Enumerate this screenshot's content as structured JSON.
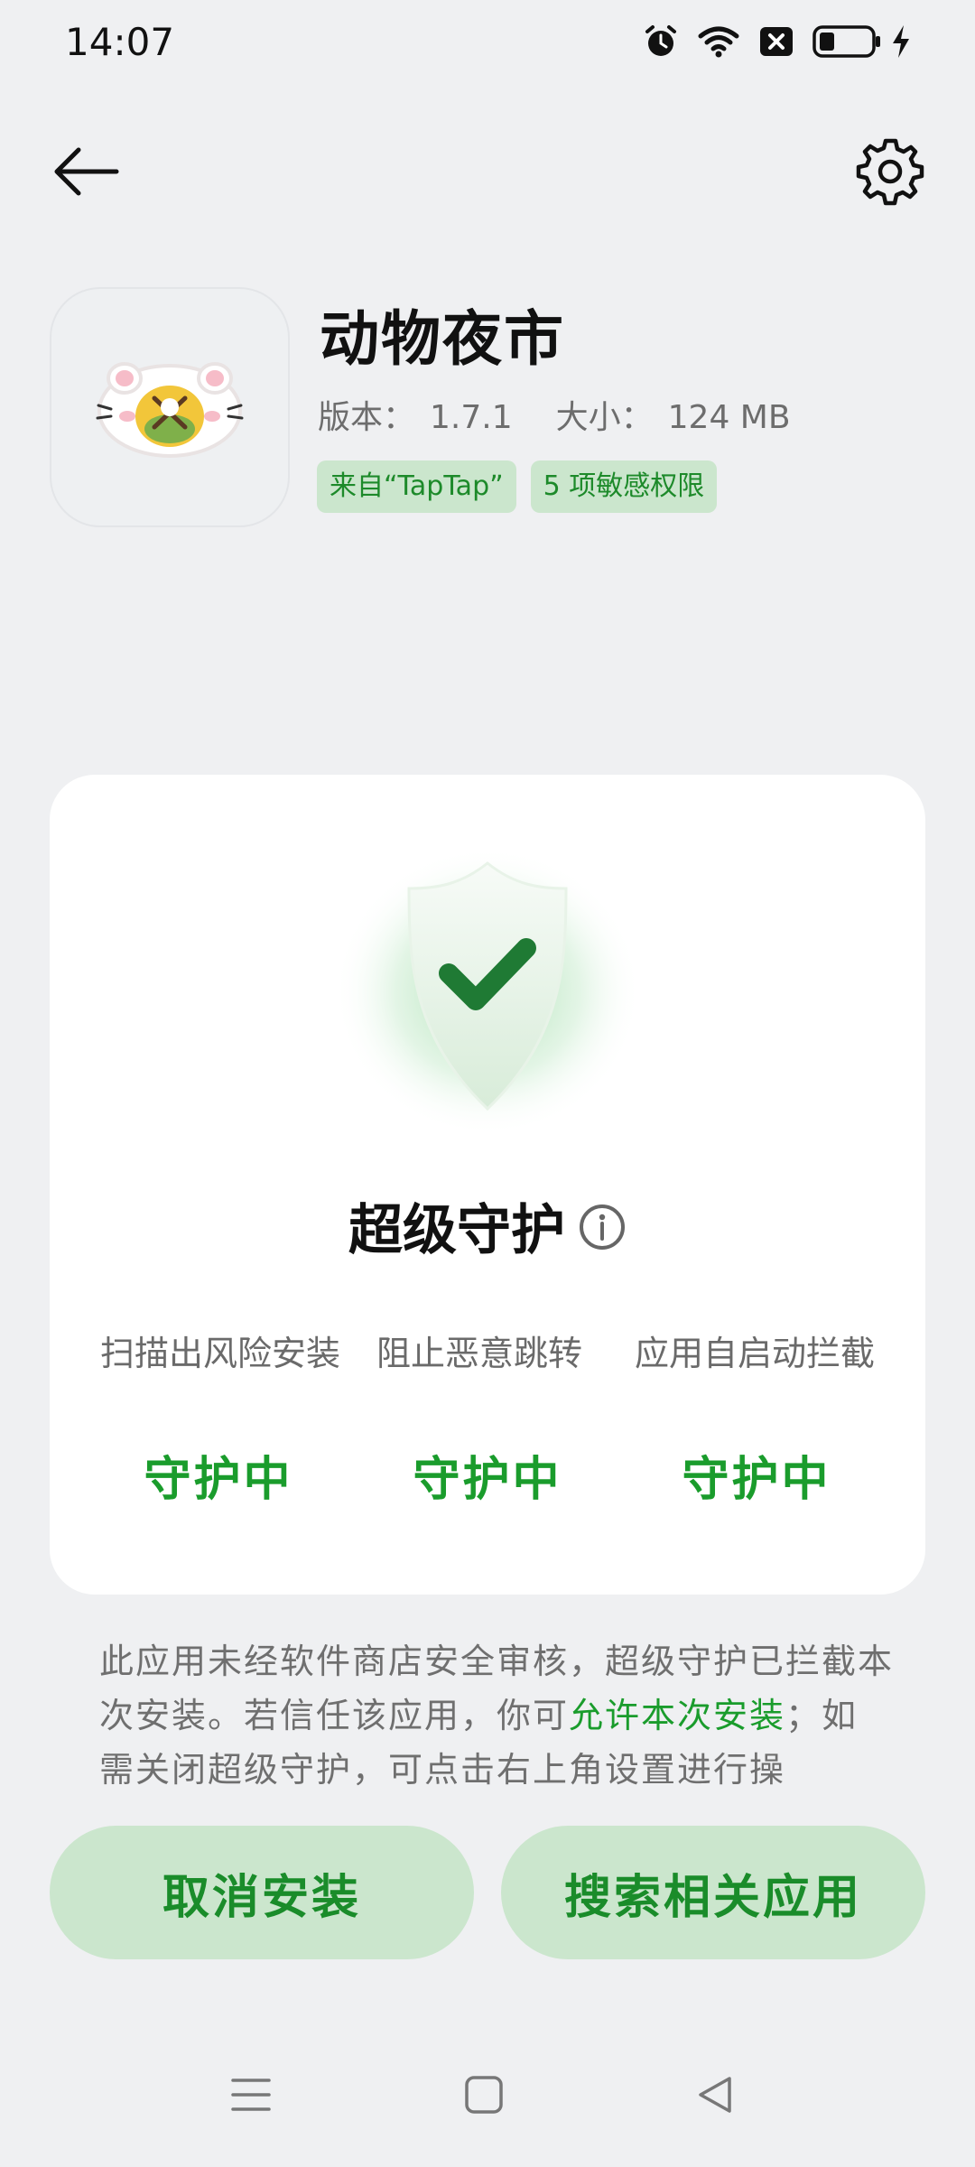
{
  "status_bar": {
    "time": "14:07",
    "icons": [
      "alarm-icon",
      "wifi-icon",
      "sim-off-icon",
      "battery-icon",
      "charging-icon"
    ]
  },
  "top_bar": {
    "back_icon": "back-arrow-icon",
    "settings_icon": "gear-icon"
  },
  "app": {
    "name": "动物夜市",
    "version_label": "版本：",
    "version": "1.7.1",
    "size_label": "大小：",
    "size": "124 MB",
    "source_chip": "来自“TapTap”",
    "permissions_chip": "5 项敏感权限"
  },
  "protection_card": {
    "title": "超级守护",
    "features": [
      {
        "label": "扫描出风险安装",
        "status": "守护中"
      },
      {
        "label": "阻止恶意跳转",
        "status": "守护中"
      },
      {
        "label": "应用自启动拦截",
        "status": "守护中"
      }
    ]
  },
  "notice": {
    "text_before": "此应用未经软件商店安全审核，超级守护已拦截本次安装。若信任该应用，你可",
    "link": "允许本次安装",
    "text_after": "；如需关闭超级守护，可点击右上角设置进行操"
  },
  "actions": {
    "cancel": "取消安装",
    "search": "搜索相关应用"
  },
  "colors": {
    "accent": "#1a9c2c",
    "chip_bg": "#cbe6cd",
    "background": "#eff0f2"
  }
}
